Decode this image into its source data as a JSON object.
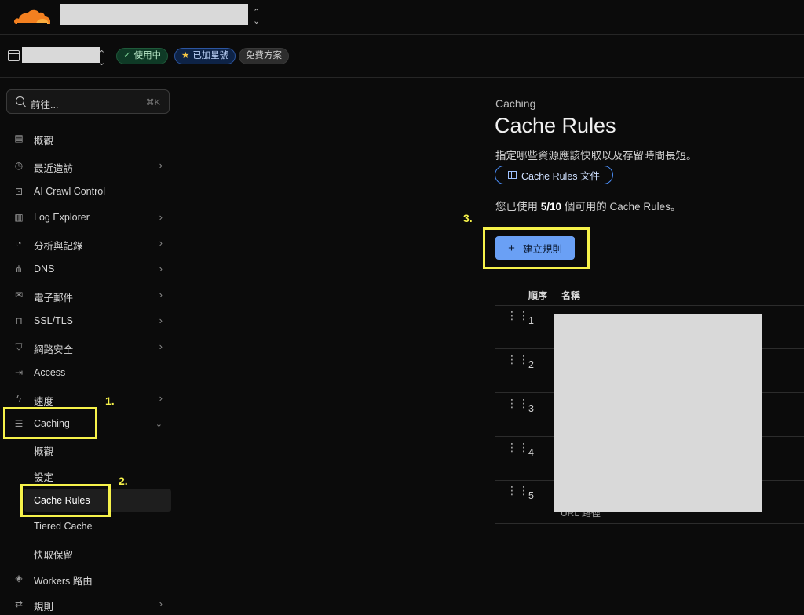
{
  "topbar": {
    "account_switcher_icon": "chevron-updown-icon"
  },
  "zone": {
    "badges": {
      "active": "使用中",
      "starred": "已加星號",
      "plan": "免費方案"
    }
  },
  "sidebar": {
    "search": {
      "label": "前往...",
      "shortcut": "⌘K"
    },
    "items": [
      {
        "label": "概觀",
        "icon": "document-icon",
        "arrow": false
      },
      {
        "label": "最近造訪",
        "icon": "clock-icon",
        "arrow": true
      },
      {
        "label": "AI Crawl Control",
        "icon": "robot-icon",
        "arrow": false
      },
      {
        "label": "Log Explorer",
        "icon": "chart-icon",
        "arrow": true
      },
      {
        "label": "分析與記錄",
        "icon": "analytics-icon",
        "arrow": true
      },
      {
        "label": "DNS",
        "icon": "network-icon",
        "arrow": true
      },
      {
        "label": "電子郵件",
        "icon": "mail-icon",
        "arrow": true
      },
      {
        "label": "SSL/TLS",
        "icon": "lock-icon",
        "arrow": true
      },
      {
        "label": "網路安全",
        "icon": "shield-icon",
        "arrow": true
      },
      {
        "label": "Access",
        "icon": "access-icon",
        "arrow": false
      },
      {
        "label": "速度",
        "icon": "lightning-icon",
        "arrow": true
      },
      {
        "label": "Caching",
        "icon": "storage-icon",
        "arrow": true
      }
    ],
    "caching_sub": [
      "概觀",
      "設定",
      "Cache Rules",
      "Tiered Cache",
      "快取保留"
    ],
    "after_items": [
      {
        "label": "Workers 路由",
        "icon": "workers-icon"
      },
      {
        "label": "規則",
        "icon": "rules-icon"
      }
    ]
  },
  "annotations": {
    "step1": "1.",
    "step2": "2.",
    "step3": "3."
  },
  "main": {
    "section": "Caching",
    "title": "Cache Rules",
    "description": "指定哪些資源應該快取以及存留時間長短。",
    "doc_button": "Cache Rules 文件",
    "usage_prefix": "您已使用 ",
    "usage_count": "5/10",
    "usage_suffix": " 個可用的 Cache Rules。",
    "create_button": "建立規則",
    "table": {
      "headers": {
        "order": "順序",
        "name": "名稱"
      },
      "rows": [
        "1",
        "2",
        "3",
        "4",
        "5"
      ],
      "peek_text": "URL 路徑"
    }
  },
  "colors": {
    "brand": "#f38020",
    "accent": "#6aa0f5",
    "highlight": "#f6f24a"
  }
}
